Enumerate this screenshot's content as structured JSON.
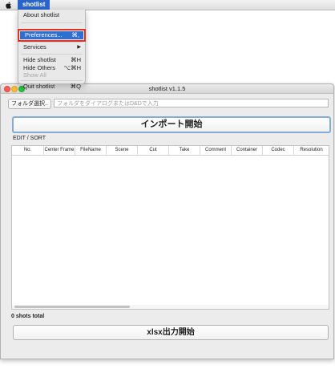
{
  "menubar": {
    "apple_icon": "apple-logo-icon",
    "app_menu": "shotlist"
  },
  "dropdown": {
    "items": [
      {
        "label": "About shotlist",
        "shortcut": "",
        "enabled": true,
        "highlighted": false
      },
      {
        "label": "Preferences...",
        "shortcut": "⌘,",
        "enabled": true,
        "highlighted": true
      },
      {
        "label": "Services",
        "shortcut": "▶",
        "enabled": true,
        "highlighted": false
      },
      {
        "label": "Hide shotlist",
        "shortcut": "⌘H",
        "enabled": true,
        "highlighted": false
      },
      {
        "label": "Hide Others",
        "shortcut": "⌥⌘H",
        "enabled": true,
        "highlighted": false
      },
      {
        "label": "Show All",
        "shortcut": "",
        "enabled": false,
        "highlighted": false
      },
      {
        "label": "Quit shotlist",
        "shortcut": "⌘Q",
        "enabled": true,
        "highlighted": false
      }
    ]
  },
  "window": {
    "title": "shotlist v1.1.5",
    "folder_button": "フォルダ選択..",
    "path_placeholder": "フォルダをダイアログまたはD&Dで入力",
    "import_button": "インポート開始",
    "edit_label": "EDIT / SORT",
    "columns": [
      "No.",
      "Center Frame",
      "FileName",
      "Scene",
      "Cut",
      "Take",
      "Comment",
      "Container",
      "Codec",
      "Resolution"
    ],
    "rows": [],
    "shots_total": "0 shots total",
    "export_button": "xlsx出力開始"
  },
  "colors": {
    "menu_highlight": "#2f6ed3",
    "annotation_outline": "#e0321e",
    "close": "#fd5f57",
    "minimize": "#febc2e",
    "zoom": "#29c740"
  }
}
